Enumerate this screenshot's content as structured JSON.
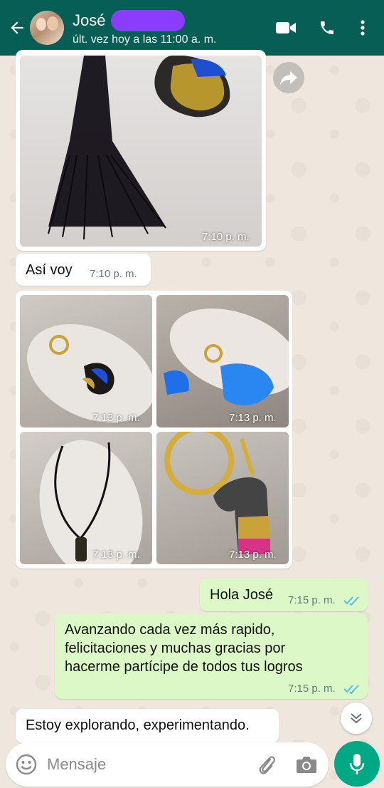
{
  "header": {
    "contact_name": "José",
    "last_seen": "últ. vez hoy a las 11:00 a. m.",
    "icons": [
      "back-arrow-icon",
      "video-call-icon",
      "phone-icon",
      "more-vert-icon"
    ]
  },
  "messages": [
    {
      "type": "image",
      "direction": "in",
      "time": "7:10 p. m."
    },
    {
      "type": "text",
      "direction": "in",
      "text": "Así voy",
      "time": "7:10 p. m."
    },
    {
      "type": "image_grid",
      "direction": "in",
      "times": [
        "7:13 p. m.",
        "7:13 p. m.",
        "7:13 p. m.",
        "7:13 p. m."
      ]
    },
    {
      "type": "text",
      "direction": "out",
      "text": "Hola José",
      "time": "7:15 p. m.",
      "status": "read"
    },
    {
      "type": "text",
      "direction": "out",
      "lines": [
        "Avanzando cada vez más rapido,",
        "felicitaciones y muchas gracias por",
        "hacerme partícipe de todos tus logros"
      ],
      "time": "7:15 p. m.",
      "status": "read"
    },
    {
      "type": "text",
      "direction": "in",
      "text": "Estoy explorando, experimentando."
    }
  ],
  "composer": {
    "placeholder": "Mensaje",
    "icons": [
      "emoji-icon",
      "attach-icon",
      "camera-icon",
      "mic-icon"
    ]
  },
  "colors": {
    "header": "#075e54",
    "outgoing_bubble": "#dcf8c6",
    "incoming_bubble": "#ffffff",
    "accent": "#00a884",
    "read_ticks": "#53bdeb"
  }
}
